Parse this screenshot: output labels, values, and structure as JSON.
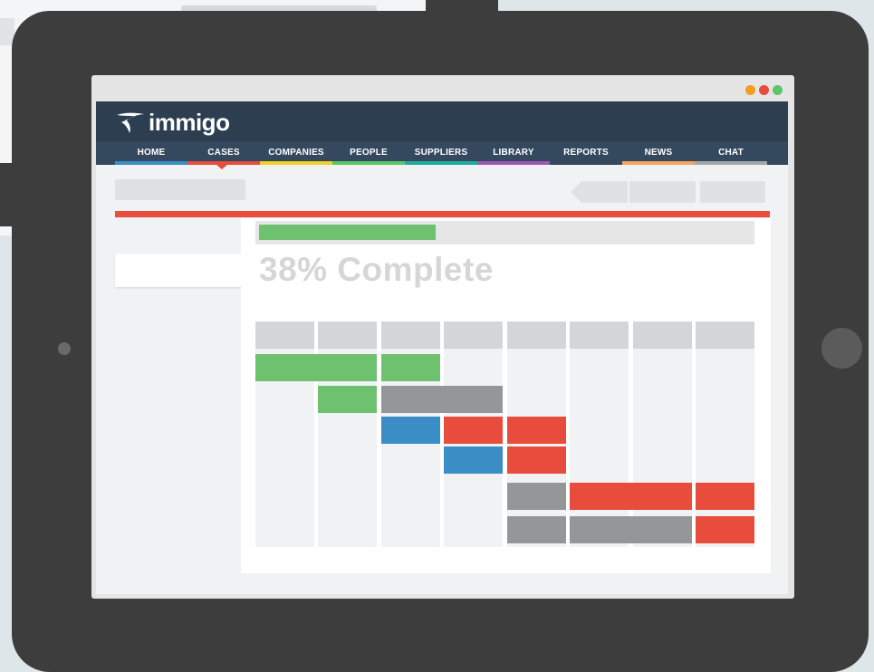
{
  "app": {
    "brand": "immigo"
  },
  "window_controls": [
    "minimize",
    "close",
    "maximize"
  ],
  "nav": {
    "items": [
      {
        "label": "HOME",
        "color": "#3a8dc5"
      },
      {
        "label": "CASES",
        "color": "#e74c3c",
        "active": true
      },
      {
        "label": "COMPANIES",
        "color": "#f1d21f"
      },
      {
        "label": "PEOPLE",
        "color": "#5cc46b"
      },
      {
        "label": "SUPPLIERS",
        "color": "#1fae9d"
      },
      {
        "label": "LIBRARY",
        "color": "#9b59b6"
      },
      {
        "label": "REPORTS",
        "color": "#34495e"
      },
      {
        "label": "NEWS",
        "color": "#f3a563"
      },
      {
        "label": "CHAT",
        "color": "#a5a7a9"
      }
    ]
  },
  "case": {
    "progress_percent": 38,
    "progress_fraction": 0.36,
    "status_text": "38% Complete"
  },
  "colors": {
    "header": "#2c3e50",
    "accent": "#e74c3c",
    "green": "#6ec16f",
    "blue": "#3a8dc5",
    "gray": "#959698"
  },
  "gantt": {
    "columns": 8,
    "tasks": [
      {
        "start": 0,
        "span": 2,
        "color": "green"
      },
      {
        "start": 2,
        "span": 1,
        "color": "green"
      },
      {
        "start": 1,
        "span": 1,
        "color": "green"
      },
      {
        "start": 2,
        "span": 2,
        "color": "gray"
      },
      {
        "start": 2,
        "span": 1,
        "color": "blue"
      },
      {
        "start": 3,
        "span": 1,
        "color": "red"
      },
      {
        "start": 4,
        "span": 1,
        "color": "red"
      },
      {
        "start": 3,
        "span": 1,
        "color": "blue"
      },
      {
        "start": 4,
        "span": 1,
        "color": "red"
      },
      {
        "start": 4,
        "span": 1,
        "color": "gray"
      },
      {
        "start": 5,
        "span": 2,
        "color": "red"
      },
      {
        "start": 7,
        "span": 1,
        "color": "red"
      },
      {
        "start": 4,
        "span": 1,
        "color": "gray"
      },
      {
        "start": 5,
        "span": 2,
        "color": "gray"
      },
      {
        "start": 7,
        "span": 1,
        "color": "red"
      }
    ]
  }
}
